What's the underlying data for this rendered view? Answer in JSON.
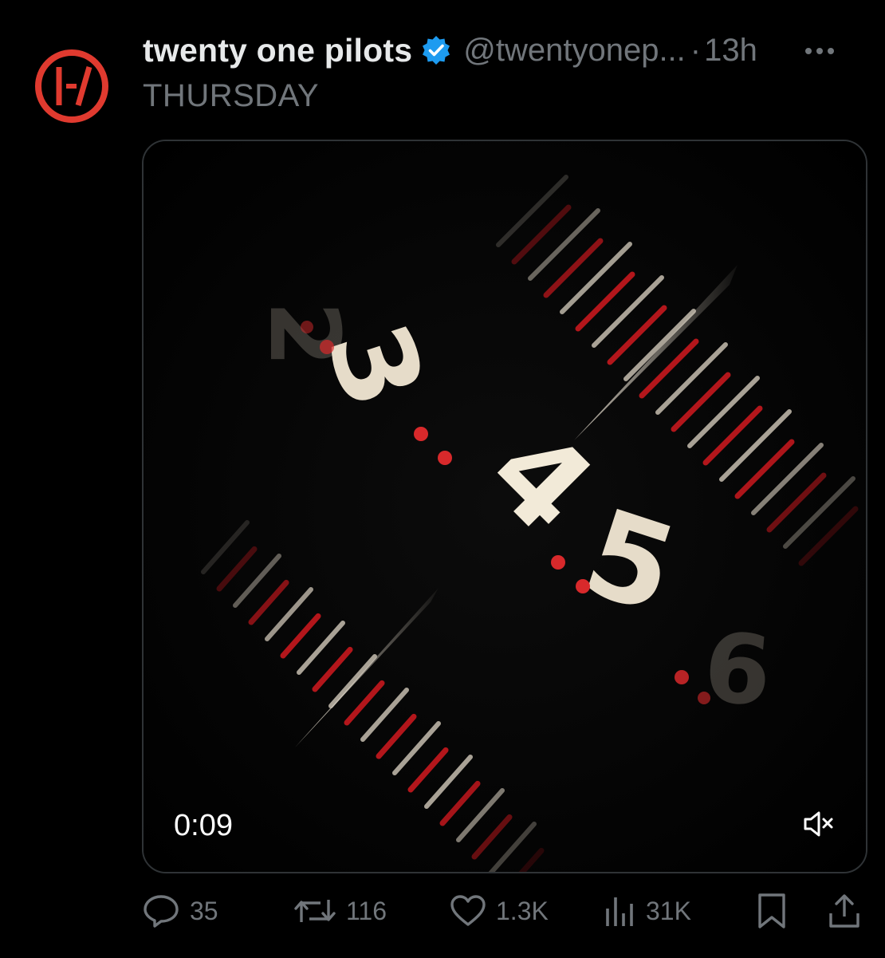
{
  "tweet": {
    "display_name": "twenty one pilots",
    "handle": "@twentyonep...",
    "separator": "·",
    "time_ago": "13h",
    "text": "THURSDAY",
    "verified": true,
    "brand_color": "#e03a2f",
    "verified_color": "#1d9bf0"
  },
  "video": {
    "elapsed": "0:09",
    "dial_numbers": [
      "2",
      "3",
      "4",
      "5",
      "6"
    ],
    "muted": true
  },
  "actions": {
    "replies": "35",
    "reposts": "116",
    "likes": "1.3K",
    "views": "31K"
  },
  "icons": {
    "avatar": "twenty-one-pilots-logo",
    "verified": "verified-badge-icon",
    "more": "more-options-icon",
    "mute": "speaker-muted-icon",
    "reply": "reply-icon",
    "repost": "repost-icon",
    "like": "heart-icon",
    "views": "views-chart-icon",
    "bookmark": "bookmark-icon",
    "share": "share-icon"
  }
}
